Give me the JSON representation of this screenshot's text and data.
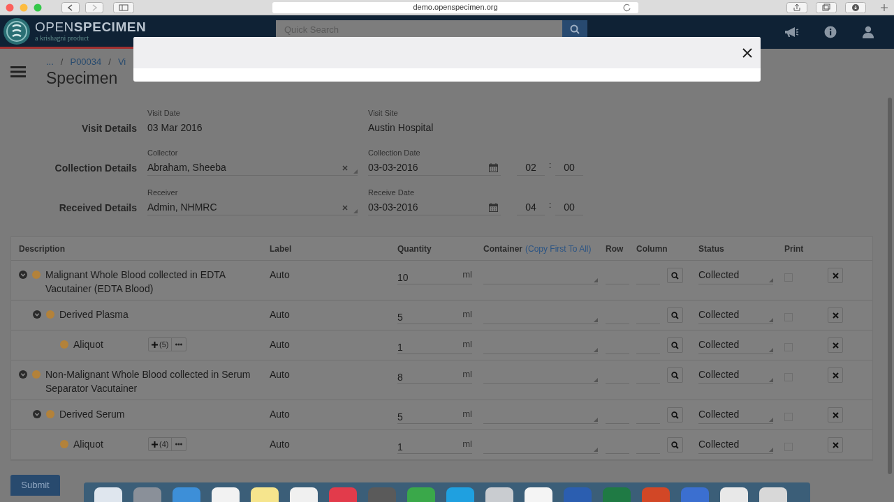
{
  "browser": {
    "url": "demo.openspecimen.org"
  },
  "app_header": {
    "brand": "OPEN**SPECIMEN**",
    "tagline": "a krishagni product",
    "search": {
      "placeholder": "Quick Search"
    }
  },
  "breadcrumbs": [
    {
      "label": "..."
    },
    {
      "separator": "/",
      "label": "P00034"
    },
    {
      "separator": "/",
      "label": "Vi"
    }
  ],
  "page_title": "Specimen",
  "details": [
    {
      "heading": "Visit Details",
      "fields": [
        {
          "kind": "static",
          "label": "Visit Date",
          "value": "03 Mar 2016"
        },
        {
          "kind": "static",
          "label": "Visit Site",
          "value": "Austin Hospital"
        }
      ]
    },
    {
      "heading": "Collection Details",
      "fields": [
        {
          "kind": "select",
          "label": "Collector",
          "value": "Abraham, Sheeba"
        },
        {
          "kind": "datetime",
          "label": "Collection Date",
          "value": "03-03-2016",
          "hour": "02",
          "separator": ":",
          "minute": "00"
        }
      ]
    },
    {
      "heading": "Received Details",
      "fields": [
        {
          "kind": "select",
          "label": "Receiver",
          "value": "Admin, NHMRC"
        },
        {
          "kind": "datetime",
          "label": "Receive Date",
          "value": "03-03-2016",
          "hour": "04",
          "separator": ":",
          "minute": "00"
        }
      ]
    }
  ],
  "table": {
    "columns": [
      {
        "label": "Description"
      },
      {
        "label": "Label"
      },
      {
        "label": "Quantity"
      },
      {
        "label": "Container",
        "link": "(Copy First To All)"
      },
      {
        "label": "Row"
      },
      {
        "label": "Column"
      },
      {
        "label": "Status"
      },
      {
        "label": "Print"
      }
    ],
    "rows": [
      {
        "kind": "specimen",
        "description": "Malignant Whole Blood collected in EDTA Vacutainer (EDTA Blood)",
        "expanded": true,
        "label": "Auto",
        "quantity": "10",
        "unit": "ml",
        "status": "Collected",
        "print": false,
        "children": [
          {
            "kind": "specimen",
            "description": "Derived Plasma",
            "expanded": true,
            "label": "Auto",
            "quantity": "5",
            "unit": "ml",
            "status": "Collected",
            "print": false,
            "children": [
              {
                "kind": "aliquot",
                "description": "Aliquot",
                "count": "(5)",
                "label": "Auto",
                "quantity": "1",
                "unit": "ml",
                "status": "Collected",
                "print": false
              }
            ]
          }
        ]
      },
      {
        "kind": "specimen",
        "description": "Non-Malignant Whole Blood collected in Serum Separator Vacutainer",
        "expanded": true,
        "label": "Auto",
        "quantity": "8",
        "unit": "ml",
        "status": "Collected",
        "print": false,
        "children": [
          {
            "kind": "specimen",
            "description": "Derived Serum",
            "expanded": true,
            "label": "Auto",
            "quantity": "5",
            "unit": "ml",
            "status": "Collected",
            "print": false,
            "children": [
              {
                "kind": "aliquot",
                "description": "Aliquot",
                "count": "(4)",
                "label": "Auto",
                "quantity": "1",
                "unit": "ml",
                "status": "Collected",
                "print": false
              }
            ]
          }
        ]
      }
    ]
  },
  "submit_button": "Submit"
}
